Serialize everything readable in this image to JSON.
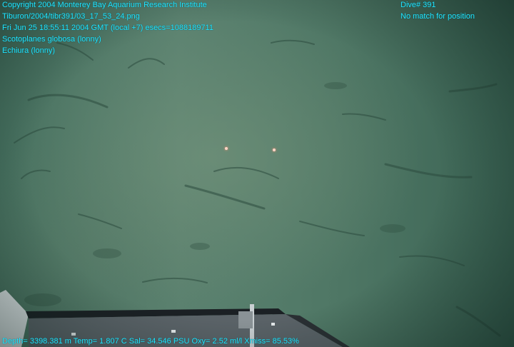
{
  "overlay": {
    "top_left": [
      "Copyright 2004 Monterey Bay Aquarium Research Institute",
      "Tiburon/2004/tibr391/03_17_53_24.png",
      "Fri Jun 25 18:55:11 2004 GMT (local +7)  esecs=1088189711",
      "Scotoplanes globosa (lonny)",
      "Echiura (lonny)"
    ],
    "top_right": [
      "Dive# 391",
      "No match for position"
    ],
    "bottom": "Depth= 3398.381 m  Temp= 1.807 C  Sal= 34.546 PSU  Oxy= 2.52 ml/l  Xmiss= 85.53%"
  },
  "colors": {
    "overlay_text": "#22e6ff",
    "seafloor": "#5b8270"
  }
}
